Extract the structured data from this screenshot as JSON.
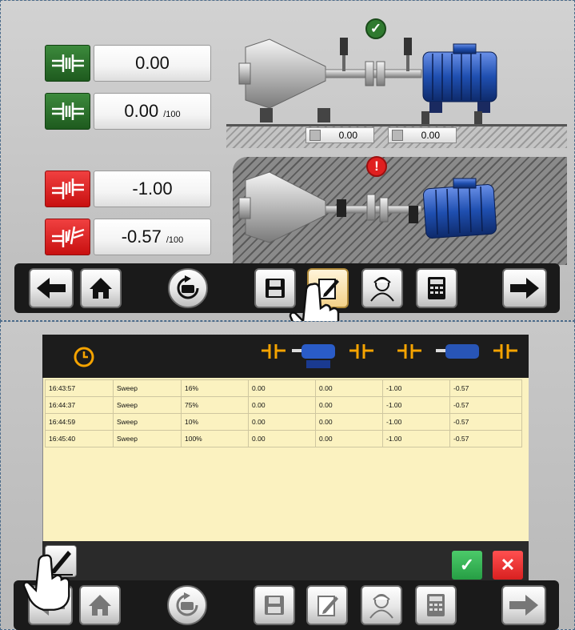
{
  "alignment_screen": {
    "rows": [
      {
        "value": "0.00",
        "unit": "",
        "status": "ok",
        "icon": "coupling-offset-icon"
      },
      {
        "value": "0.00",
        "unit": "/100",
        "status": "ok",
        "icon": "coupling-angle-icon"
      },
      {
        "value": "-1.00",
        "unit": "",
        "status": "bad",
        "icon": "coupling-offset-icon"
      },
      {
        "value": "-0.57",
        "unit": "/100",
        "status": "bad",
        "icon": "coupling-angle-icon"
      }
    ],
    "readouts_top": [
      "0.00",
      "0.00"
    ],
    "colors": {
      "ok": "#2f7a2f",
      "bad": "#e02020",
      "accent": "#f5a300",
      "motor": "#1f4fb0"
    }
  },
  "toolbar_icons": [
    "arrow-left-icon",
    "home-icon",
    "rotate-machine-icon",
    "save-icon",
    "edit-note-icon",
    "operator-icon",
    "calculator-icon",
    "arrow-right-icon"
  ],
  "history": {
    "rows": [
      [
        "16:43:57",
        "Sweep",
        "16%",
        "0.00",
        "0.00",
        "-1.00",
        "-0.57"
      ],
      [
        "16:44:37",
        "Sweep",
        "75%",
        "0.00",
        "0.00",
        "-1.00",
        "-0.57"
      ],
      [
        "16:44:59",
        "Sweep",
        "10%",
        "0.00",
        "0.00",
        "-1.00",
        "-0.57"
      ],
      [
        "16:45:40",
        "Sweep",
        "100%",
        "0.00",
        "0.00",
        "-1.00",
        "-0.57"
      ]
    ]
  }
}
